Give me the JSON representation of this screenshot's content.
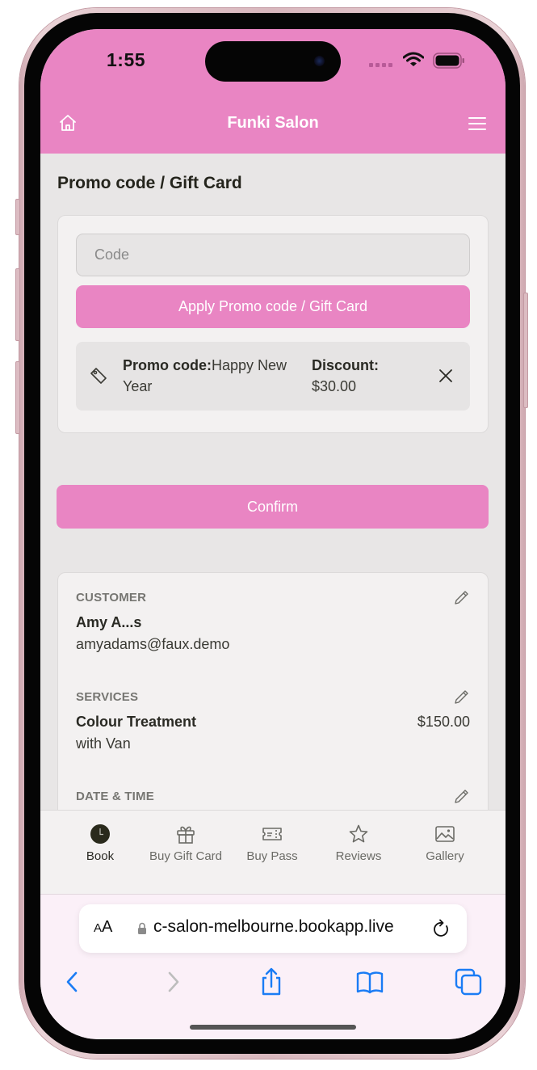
{
  "status_bar": {
    "time": "1:55"
  },
  "header": {
    "title": "Funki Salon",
    "home_icon": "home-icon",
    "menu_icon": "hamburger-menu-icon"
  },
  "promo_section": {
    "title": "Promo code / Gift Card",
    "code_input": {
      "placeholder": "Code",
      "value": ""
    },
    "apply_label": "Apply Promo code / Gift Card",
    "applied": {
      "promo_label": "Promo code:",
      "promo_value": "Happy New Year",
      "discount_label": "Discount:",
      "discount_value": "$30.00"
    }
  },
  "confirm_label": "Confirm",
  "summary": {
    "customer": {
      "label": "CUSTOMER",
      "name": "Amy A...s",
      "email": "amyadams@faux.demo"
    },
    "services": {
      "label": "SERVICES",
      "name": "Colour Treatment",
      "staff": "with Van",
      "price": "$150.00"
    },
    "date_time": {
      "label": "DATE & TIME"
    }
  },
  "bottom_nav": {
    "items": [
      {
        "label": "Book",
        "icon": "clock-icon",
        "active": true
      },
      {
        "label": "Buy Gift Card",
        "icon": "gift-icon",
        "active": false
      },
      {
        "label": "Buy Pass",
        "icon": "ticket-icon",
        "active": false
      },
      {
        "label": "Reviews",
        "icon": "star-icon",
        "active": false
      },
      {
        "label": "Gallery",
        "icon": "image-icon",
        "active": false
      }
    ]
  },
  "browser": {
    "aa_small": "A",
    "aa_large": "A",
    "url": "c-salon-melbourne.bookapp.live"
  },
  "colors": {
    "brand_pink": "#e985c3",
    "page_bg": "#e8e6e6",
    "card_bg": "#f3f1f1",
    "safari_blue": "#1a7cf5"
  }
}
